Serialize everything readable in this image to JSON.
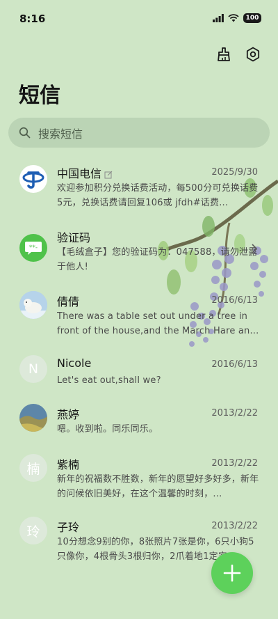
{
  "status_bar": {
    "time": "8:16",
    "battery": "100"
  },
  "header": {
    "title": "短信"
  },
  "search": {
    "placeholder": "搜索短信"
  },
  "messages": [
    {
      "name": "中国电信",
      "date": "2025/9/30",
      "preview": "欢迎参加积分兑换话费活动，每500分可兑换话费5元，兑换话费请回复106或 jfdh#话费...",
      "avatar_icon": "china-telecom-logo-icon"
    },
    {
      "name": "验证码",
      "date": "",
      "preview": "【毛绒盒子】您的验证码为：047588，请勿泄露于他人!",
      "avatar_icon": "chat-bubble-icon"
    },
    {
      "name": "倩倩",
      "date": "2016/6/13",
      "preview": "There was a table set out under a tree in front of the house,and the March Hare an...",
      "avatar_icon": "polar-bear-photo-icon"
    },
    {
      "name": "Nicole",
      "date": "2016/6/13",
      "preview": "Let's eat out,shall we?",
      "avatar_letter": "N"
    },
    {
      "name": "燕婷",
      "date": "2013/2/22",
      "preview": "嗯。收到啦。同乐同乐。",
      "avatar_icon": "landscape-photo-icon"
    },
    {
      "name": "紫楠",
      "date": "2013/2/22",
      "preview": "新年的祝福数不胜数，新年的愿望好多好多，新年的问候依旧美好，在这个温馨的时刻，...",
      "avatar_letter": "楠"
    },
    {
      "name": "子玲",
      "date": "2013/2/22",
      "preview": "10分想念9别的你，8张照片7张是你，6只小狗5只像你，4根骨头3根归你，2爪着地1定实...",
      "avatar_letter": "玲"
    }
  ],
  "colors": {
    "background": "#cfe6c6",
    "accent": "#5dd15b",
    "search_bg": "#b7d0b2"
  }
}
